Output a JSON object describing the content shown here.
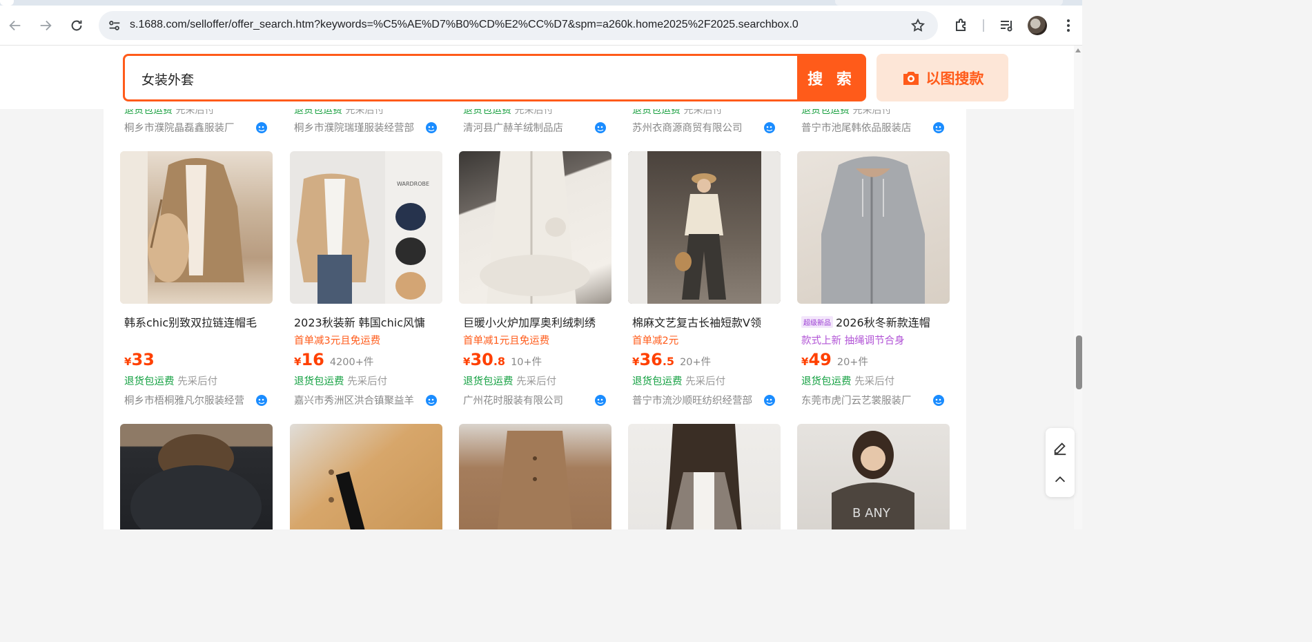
{
  "browser": {
    "url": "s.1688.com/selloffer/offer_search.htm?keywords=%C5%AE%D7%B0%CD%E2%CC%D7&spm=a260k.home2025%2F2025.searchbox.0"
  },
  "search": {
    "query": "女装外套",
    "search_button": "搜 索",
    "image_search_button": "以图搜款"
  },
  "colors": {
    "brand_orange": "#ff5b1a",
    "service_green": "#13a041",
    "promo_purple": "#b153d6"
  },
  "prev_row": [
    {
      "service_a": "退货包运费",
      "service_b": "先采后付",
      "shop": "桐乡市濮院晶磊鑫服装厂"
    },
    {
      "service_a": "退货包运费",
      "service_b": "先采后付",
      "shop": "桐乡市濮院瑞瑾服装经营部"
    },
    {
      "service_a": "退货包运费",
      "service_b": "先采后付",
      "shop": "清河县广赫羊绒制品店"
    },
    {
      "service_a": "退货包运费",
      "service_b": "先采后付",
      "shop": "苏州衣商源商贸有限公司"
    },
    {
      "service_a": "退货包运费",
      "service_b": "先采后付",
      "shop": "普宁市池尾韩依品服装店"
    }
  ],
  "products": [
    {
      "tag": "",
      "title": "韩系chic别致双拉链连帽毛",
      "promo": "",
      "currency": "¥",
      "price_int": "33",
      "price_dec": "",
      "moq": "",
      "service_a": "退货包运费",
      "service_b": "先采后付",
      "shop": "桐乡市梧桐雅凡尔服装经营"
    },
    {
      "tag": "",
      "title": "2023秋装新 韩国chic风慵",
      "promo": "首单减3元且免运费",
      "currency": "¥",
      "price_int": "16",
      "price_dec": "",
      "moq": "4200+件",
      "service_a": "退货包运费",
      "service_b": "先采后付",
      "shop": "嘉兴市秀洲区洪合镇聚益羊"
    },
    {
      "tag": "",
      "title": "巨暖小火炉加厚奥利绒刺绣",
      "promo": "首单减1元且免运费",
      "currency": "¥",
      "price_int": "30",
      "price_dec": ".8",
      "moq": "10+件",
      "service_a": "退货包运费",
      "service_b": "先采后付",
      "shop": "广州花时服装有限公司"
    },
    {
      "tag": "",
      "title": "棉麻文艺复古长袖短款V领",
      "promo": "首单减2元",
      "currency": "¥",
      "price_int": "36",
      "price_dec": ".5",
      "moq": "20+件",
      "service_a": "退货包运费",
      "service_b": "先采后付",
      "shop": "普宁市流沙顺旺纺织经营部"
    },
    {
      "tag": "超级新品",
      "title": "2026秋冬新款连帽",
      "promo": "款式上新 抽绳调节合身",
      "currency": "¥",
      "price_int": "49",
      "price_dec": "",
      "moq": "20+件",
      "service_a": "退货包运费",
      "service_b": "先采后付",
      "shop": "东莞市虎门云艺裳服装厂"
    }
  ],
  "icons": {
    "back": "arrow-left-icon",
    "forward": "arrow-right-icon",
    "reload": "reload-icon",
    "site_info": "tune-icon",
    "bookmark": "star-icon",
    "extensions": "puzzle-icon",
    "media": "playlist-icon",
    "menu": "kebab-menu-icon",
    "camera": "camera-icon",
    "wangwang": "wangwang-chat-icon",
    "edit": "pencil-icon",
    "top": "chevron-up-icon"
  }
}
